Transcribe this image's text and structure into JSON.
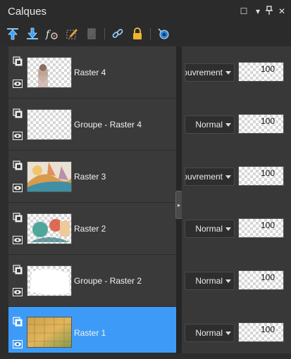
{
  "panel": {
    "title": "Calques"
  },
  "window_controls": [
    {
      "name": "restore-icon",
      "glyph": "☐"
    },
    {
      "name": "dropdown-icon",
      "glyph": "▾"
    },
    {
      "name": "pin-icon",
      "glyph": "⊥"
    },
    {
      "name": "close-icon",
      "glyph": "✕"
    }
  ],
  "toolbar": [
    {
      "name": "move-layer-up-icon"
    },
    {
      "name": "move-layer-down-icon"
    },
    {
      "name": "layer-effects-icon"
    },
    {
      "name": "edit-selection-icon"
    },
    {
      "name": "lock-transparency-icon"
    },
    {
      "name": "link-layers-icon"
    },
    {
      "name": "lock-layer-icon"
    },
    {
      "name": "layer-properties-icon"
    }
  ],
  "layers": [
    {
      "name": "Raster 4",
      "blend": "Recouvrement",
      "opacity": "100",
      "selected": false,
      "thumb": "portrait"
    },
    {
      "name": "Groupe - Raster 4",
      "blend": "Normal",
      "opacity": "100",
      "selected": false,
      "thumb": "empty"
    },
    {
      "name": "Raster 3",
      "blend": "Recouvrement",
      "opacity": "100",
      "selected": false,
      "thumb": "abstract"
    },
    {
      "name": "Raster 2",
      "blend": "Normal",
      "opacity": "100",
      "selected": false,
      "thumb": "shapes"
    },
    {
      "name": "Groupe - Raster 2",
      "blend": "Normal",
      "opacity": "100",
      "selected": false,
      "thumb": "white"
    },
    {
      "name": "Raster 1",
      "blend": "Normal",
      "opacity": "100",
      "selected": true,
      "thumb": "gold"
    }
  ],
  "colors": {
    "accent": "#3d9bf7",
    "panel_bg": "#2d2d2d",
    "row_bg": "#3a3a3a"
  }
}
